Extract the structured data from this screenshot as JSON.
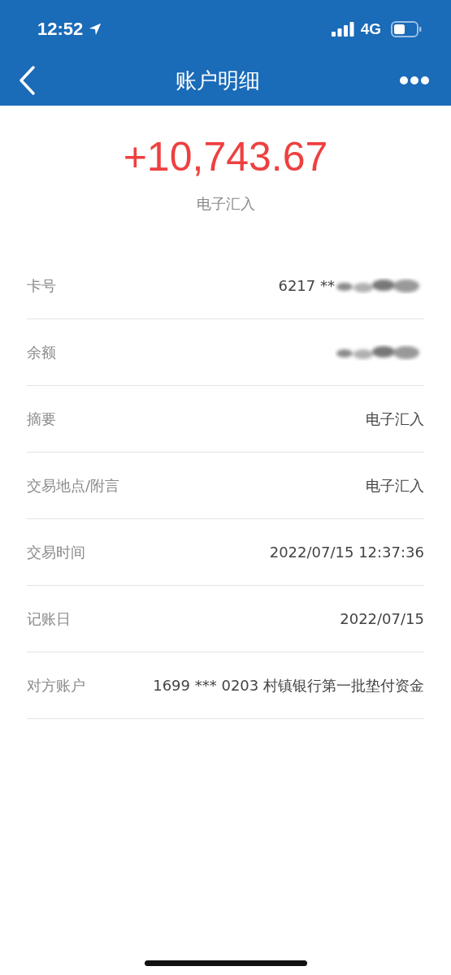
{
  "status_bar": {
    "time": "12:52",
    "network": "4G"
  },
  "nav": {
    "title": "账户明细"
  },
  "amount": {
    "value": "+10,743.67",
    "caption": "电子汇入"
  },
  "rows": [
    {
      "label": "卡号",
      "value": "6217 **",
      "redacted": true
    },
    {
      "label": "余额",
      "redacted": true
    },
    {
      "label": "摘要",
      "value": "电子汇入"
    },
    {
      "label": "交易地点/附言",
      "value": "电子汇入"
    },
    {
      "label": "交易时间",
      "value": "2022/07/15 12:37:36"
    },
    {
      "label": "记账日",
      "value": "2022/07/15"
    },
    {
      "label": "对方账户",
      "value": "1699 *** 0203 村镇银行第一批垫付资金"
    }
  ]
}
